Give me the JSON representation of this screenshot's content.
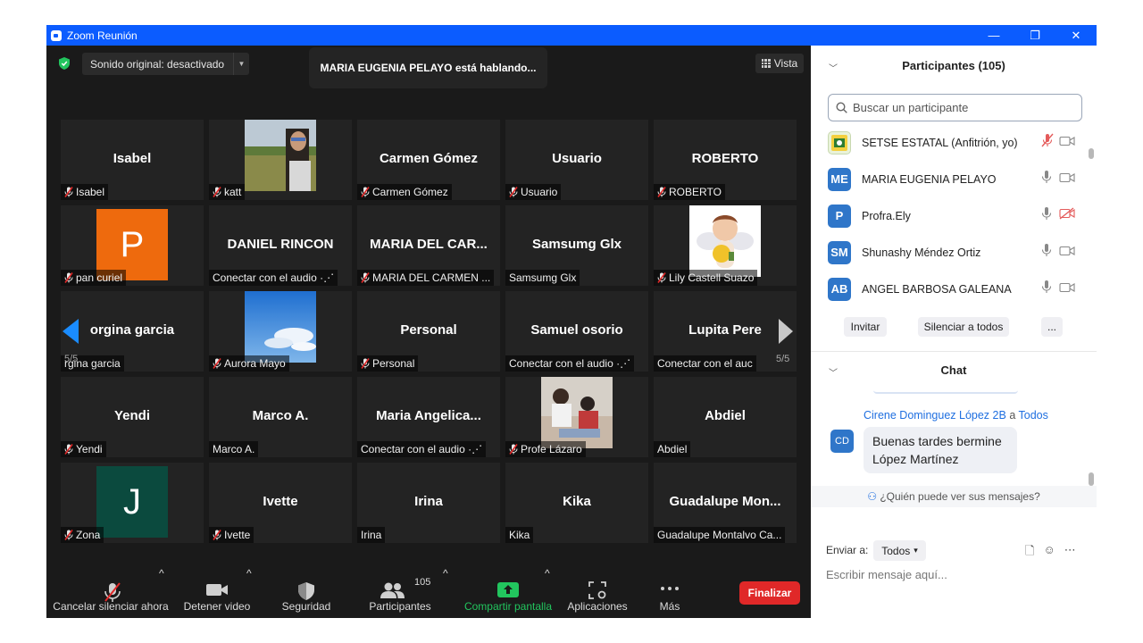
{
  "window": {
    "title": "Zoom Reunión",
    "controls": [
      "—",
      "❐",
      "✕"
    ]
  },
  "topbar": {
    "sound_label": "Sonido original: desactivado",
    "speaking_text": "MARIA EUGENIA PELAYO está hablando...",
    "view_label": "Vista"
  },
  "gallery": {
    "page_left": "5/5",
    "page_right": "5/5",
    "tiles": [
      {
        "name": "Isabel",
        "tag": "Isabel",
        "muted": true,
        "kind": "name"
      },
      {
        "name": "",
        "tag": "katt",
        "muted": true,
        "kind": "photo-field"
      },
      {
        "name": "Carmen Gómez",
        "tag": "Carmen Gómez",
        "muted": true,
        "kind": "name"
      },
      {
        "name": "Usuario",
        "tag": "Usuario",
        "muted": true,
        "kind": "name"
      },
      {
        "name": "ROBERTO",
        "tag": "ROBERTO",
        "muted": true,
        "kind": "name"
      },
      {
        "name": "",
        "tag": "pan curiel",
        "muted": true,
        "kind": "letter",
        "letter": "P",
        "color": "#ee6a0d"
      },
      {
        "name": "DANIEL RINCON",
        "tag": "Conectar con el audio ·⋰",
        "muted": false,
        "kind": "name"
      },
      {
        "name": "MARIA DEL CAR...",
        "tag": "MARIA DEL CARMEN ...",
        "muted": true,
        "kind": "name"
      },
      {
        "name": "Samsumg Glx",
        "tag": "Samsumg Glx",
        "muted": false,
        "kind": "name"
      },
      {
        "name": "",
        "tag": "Lily Castell Suazo",
        "muted": true,
        "kind": "photo-angel"
      },
      {
        "name": "orgina garcia",
        "tag": "rgina garcia",
        "muted": false,
        "kind": "name"
      },
      {
        "name": "",
        "tag": "Aurora Mayo",
        "muted": true,
        "kind": "photo-sky"
      },
      {
        "name": "Personal",
        "tag": "Personal",
        "muted": true,
        "kind": "name"
      },
      {
        "name": "Samuel osorio",
        "tag": "Conectar con el audio ·⋰",
        "muted": false,
        "kind": "name"
      },
      {
        "name": "Lupita Pere",
        "tag": "Conectar con el auc",
        "muted": false,
        "kind": "name"
      },
      {
        "name": "Yendi",
        "tag": "Yendi",
        "muted": true,
        "kind": "name"
      },
      {
        "name": "Marco A.",
        "tag": "Marco A.",
        "muted": false,
        "kind": "name"
      },
      {
        "name": "Maria  Angelica...",
        "tag": "Conectar con el audio ·⋰",
        "muted": false,
        "kind": "name"
      },
      {
        "name": "",
        "tag": "Profe Lázaro",
        "muted": true,
        "kind": "photo-kids"
      },
      {
        "name": "Abdiel",
        "tag": "Abdiel",
        "muted": false,
        "kind": "name"
      },
      {
        "name": "",
        "tag": "Zona",
        "muted": true,
        "kind": "letter",
        "letter": "J",
        "color": "#0b4a3e"
      },
      {
        "name": "Ivette",
        "tag": "Ivette",
        "muted": true,
        "kind": "name"
      },
      {
        "name": "Irina",
        "tag": "Irina",
        "muted": false,
        "kind": "name"
      },
      {
        "name": "Kika",
        "tag": "Kika",
        "muted": false,
        "kind": "name"
      },
      {
        "name": "Guadalupe  Mon...",
        "tag": "Guadalupe Montalvo Ca...",
        "muted": false,
        "kind": "name"
      }
    ]
  },
  "toolbar": {
    "unmute_label": "Cancelar silenciar ahora",
    "video_label": "Detener video",
    "security_label": "Seguridad",
    "participants_label": "Participantes",
    "participants_count": "105",
    "share_label": "Compartir pantalla",
    "apps_label": "Aplicaciones",
    "more_label": "Más",
    "end_label": "Finalizar",
    "share_color": "#22c55e"
  },
  "participants": {
    "header": "Participantes (105)",
    "search_placeholder": "Buscar un participante",
    "rows": [
      {
        "initials": "",
        "name": "SETSE ESTATAL (Anfitrión, yo)",
        "mic": "muted",
        "cam": "on",
        "color": "#e9f3d9"
      },
      {
        "initials": "ME",
        "name": "MARIA EUGENIA PELAYO",
        "mic": "on",
        "cam": "on",
        "color": "#2f76c9"
      },
      {
        "initials": "P",
        "name": "Profra.Ely",
        "mic": "on",
        "cam": "off",
        "color": "#2f76c9"
      },
      {
        "initials": "SM",
        "name": "Shunashy Méndez Ortiz",
        "mic": "on",
        "cam": "on",
        "color": "#2f76c9"
      },
      {
        "initials": "AB",
        "name": "ANGEL BARBOSA GALEANA",
        "mic": "on",
        "cam": "on",
        "color": "#2f76c9"
      }
    ],
    "invite_label": "Invitar",
    "mute_all_label": "Silenciar a todos",
    "more_label": "..."
  },
  "chat": {
    "header": "Chat",
    "message": {
      "from": "Cirene Dominguez López 2B",
      "to_word": "a",
      "to": "Todos",
      "avatar": "CD",
      "text": "Buenas tardes bermine López Martínez"
    },
    "who_can_see": "¿Quién puede ver sus mensajes?",
    "send_to_label": "Enviar a:",
    "send_to_value": "Todos",
    "input_placeholder": "Escribir mensaje aquí..."
  }
}
